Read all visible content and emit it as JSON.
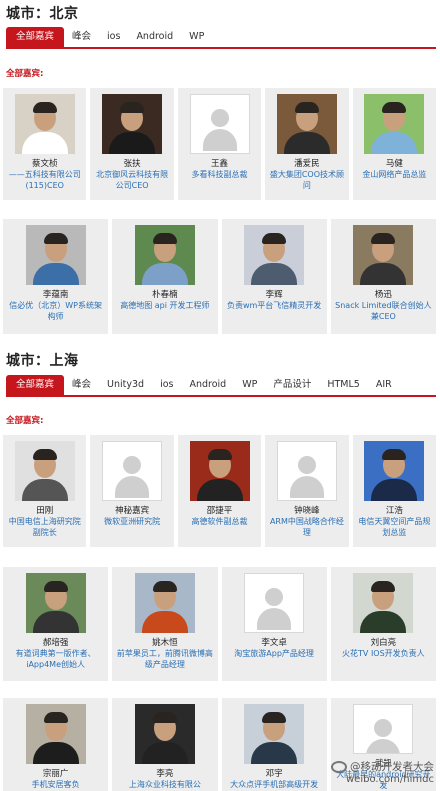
{
  "beijing": {
    "city_title": "城市：北京",
    "tabs": [
      "全部嘉宾",
      "峰会",
      "ios",
      "Android",
      "WP"
    ],
    "section_label": "全部嘉宾:",
    "row1": [
      {
        "name": "蔡文桢",
        "title": "——五科技有限公司(115)CEO",
        "photo": "pic",
        "shirt": "#ffffff",
        "bg": "#d8d2c6"
      },
      {
        "name": "张扶",
        "title": "北京御风云科技有限公司CEO",
        "photo": "pic",
        "shirt": "#1a1a1a",
        "bg": "#3a2a22"
      },
      {
        "name": "王鑫",
        "title": "多看科技副总裁",
        "photo": "placeholder"
      },
      {
        "name": "潘爱民",
        "title": "盛大集团COO技术顾问",
        "photo": "pic",
        "shirt": "#2b2b2b",
        "bg": "#7a5a3a"
      },
      {
        "name": "马健",
        "title": "金山网络产品总监",
        "photo": "pic",
        "shirt": "#7fb2d8",
        "bg": "#8cbf6a"
      }
    ],
    "row2": [
      {
        "name": "李蕴南",
        "title": "信必优（北京）WP系统架构师",
        "photo": "pic",
        "shirt": "#3c6ea8",
        "bg": "#b9b9b9"
      },
      {
        "name": "朴春楠",
        "title": "高德地图 api 开发工程师",
        "photo": "pic",
        "shirt": "#7da0c8",
        "bg": "#5f8a4f"
      },
      {
        "name": "李辉",
        "title": "负责wm平台飞信精灵开发",
        "photo": "pic",
        "shirt": "#4e5c70",
        "bg": "#c9ced8"
      },
      {
        "name": "杨迅",
        "title": "Snack Limited联合创始人兼CEO",
        "photo": "pic",
        "shirt": "#333333",
        "bg": "#8a7a60"
      }
    ]
  },
  "shanghai": {
    "city_title": "城市：上海",
    "tabs": [
      "全部嘉宾",
      "峰会",
      "Unity3d",
      "ios",
      "Android",
      "WP",
      "产品设计",
      "HTML5",
      "AIR"
    ],
    "section_label": "全部嘉宾:",
    "row1": [
      {
        "name": "田刚",
        "title": "中国电信上海研究院副院长",
        "photo": "pic",
        "shirt": "#555555",
        "bg": "#e0e0e0"
      },
      {
        "name": "神秘嘉宾",
        "title": "微软亚洲研究院",
        "photo": "placeholder"
      },
      {
        "name": "邵捷平",
        "title": "高德软件副总裁",
        "photo": "pic",
        "shirt": "#222222",
        "bg": "#9a2a1a"
      },
      {
        "name": "钟晓峰",
        "title": "ARM中国战略合作经理",
        "photo": "placeholder"
      },
      {
        "name": "江浩",
        "title": "电信天翼空间产品规划总监",
        "photo": "pic",
        "shirt": "#1a2a48",
        "bg": "#3b6fc4"
      }
    ],
    "row2": [
      {
        "name": "郝培强",
        "title": "有道词典第一版作者、iApp4Me创始人",
        "photo": "pic",
        "shirt": "#333333",
        "bg": "#6a8a5a"
      },
      {
        "name": "姚木恒",
        "title": "前苹果员工，前腾讯微博高级产品经理",
        "photo": "pic",
        "shirt": "#c84a1c",
        "bg": "#a9b8c8"
      },
      {
        "name": "李文卓",
        "title": "淘宝旅游App产品经理",
        "photo": "placeholder"
      },
      {
        "name": "刘白亮",
        "title": "火花TV IOS开发负责人",
        "photo": "pic",
        "shirt": "#2a3d2a",
        "bg": "#d2d7cf"
      }
    ],
    "row3": [
      {
        "name": "宗丽广",
        "title": "手机安居客负",
        "photo": "pic",
        "shirt": "#1d1d1d",
        "bg": "#b6b0a2"
      },
      {
        "name": "李亮",
        "title": "上海众业科技有限公",
        "photo": "pic",
        "shirt": "#222222",
        "bg": "#2a2a2a"
      },
      {
        "name": "邓宇",
        "title": "大众点评手机部高级开发",
        "photo": "pic",
        "shirt": "#283848",
        "bg": "#c7cfd8"
      },
      {
        "name": "武凯",
        "title": "大陆最早的android研究开发",
        "photo": "placeholder"
      }
    ]
  },
  "watermark": {
    "line1": "@移动开发者大会",
    "line2": "weibo.com/himdc"
  }
}
